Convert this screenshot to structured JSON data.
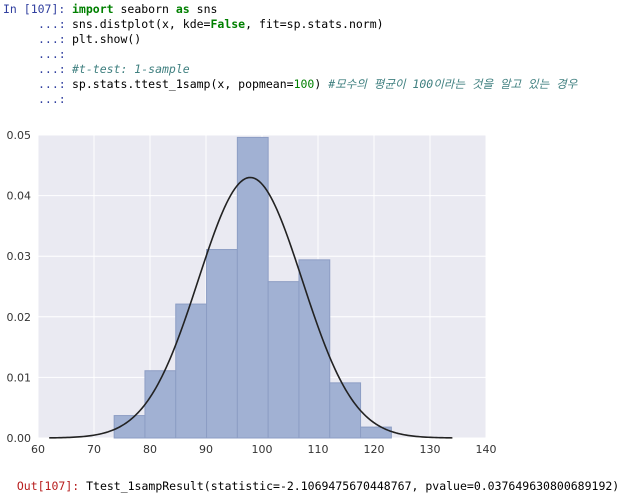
{
  "input_cell": {
    "prompt": "In [107]:",
    "continuation": "...:",
    "lines": [
      {
        "segments": [
          {
            "t": "import",
            "c": "kw"
          },
          {
            "t": " seaborn ",
            "c": ""
          },
          {
            "t": "as",
            "c": "kw"
          },
          {
            "t": " sns",
            "c": ""
          }
        ]
      },
      {
        "segments": [
          {
            "t": "sns.distplot(x, kde=",
            "c": ""
          },
          {
            "t": "False",
            "c": "kwc"
          },
          {
            "t": ", fit=sp.stats.norm)",
            "c": ""
          }
        ]
      },
      {
        "segments": [
          {
            "t": "plt.show()",
            "c": ""
          }
        ]
      },
      {
        "segments": []
      },
      {
        "segments": [
          {
            "t": "#t-test: 1-sample",
            "c": "cm"
          }
        ]
      },
      {
        "segments": [
          {
            "t": "sp.stats.ttest_1samp(x, popmean=",
            "c": ""
          },
          {
            "t": "100",
            "c": "num"
          },
          {
            "t": ") ",
            "c": ""
          },
          {
            "t": "#모수의 평균이 100이라는 것을 알고 있는 경우",
            "c": "cm"
          }
        ]
      },
      {
        "segments": []
      }
    ]
  },
  "chart_data": {
    "type": "bar",
    "bins": [
      {
        "x0": 73.6,
        "x1": 79.1,
        "density": 0.0037
      },
      {
        "x0": 79.1,
        "x1": 84.6,
        "density": 0.0111
      },
      {
        "x0": 84.6,
        "x1": 90.1,
        "density": 0.0221
      },
      {
        "x0": 90.1,
        "x1": 95.6,
        "density": 0.0311
      },
      {
        "x0": 95.6,
        "x1": 101.1,
        "density": 0.0496
      },
      {
        "x0": 101.1,
        "x1": 106.6,
        "density": 0.0258
      },
      {
        "x0": 106.6,
        "x1": 112.1,
        "density": 0.0294
      },
      {
        "x0": 112.1,
        "x1": 117.6,
        "density": 0.0091
      },
      {
        "x0": 117.6,
        "x1": 123.1,
        "density": 0.0018
      }
    ],
    "fit_curve": {
      "distribution": "norm",
      "mean": 97.9,
      "std": 9.28,
      "x_range": [
        62.0,
        134.0
      ]
    },
    "xlim": [
      60,
      140
    ],
    "ylim": [
      0,
      0.05
    ],
    "xticks": [
      "60",
      "70",
      "80",
      "90",
      "100",
      "110",
      "120",
      "130",
      "140"
    ],
    "yticks": [
      "0.00",
      "0.01",
      "0.02",
      "0.03",
      "0.04",
      "0.05"
    ],
    "grid": true,
    "colors": {
      "background": "#eaeaf2",
      "bar": "#a1b1d3",
      "bar_edge": "#8c9dc4",
      "curve": "#222222",
      "grid": "#ffffff"
    }
  },
  "output_cell": {
    "prompt": "Out[107]:",
    "text": " Ttest_1sampResult(statistic=-2.1069475670448767, pvalue=0.037649630800689192)"
  }
}
